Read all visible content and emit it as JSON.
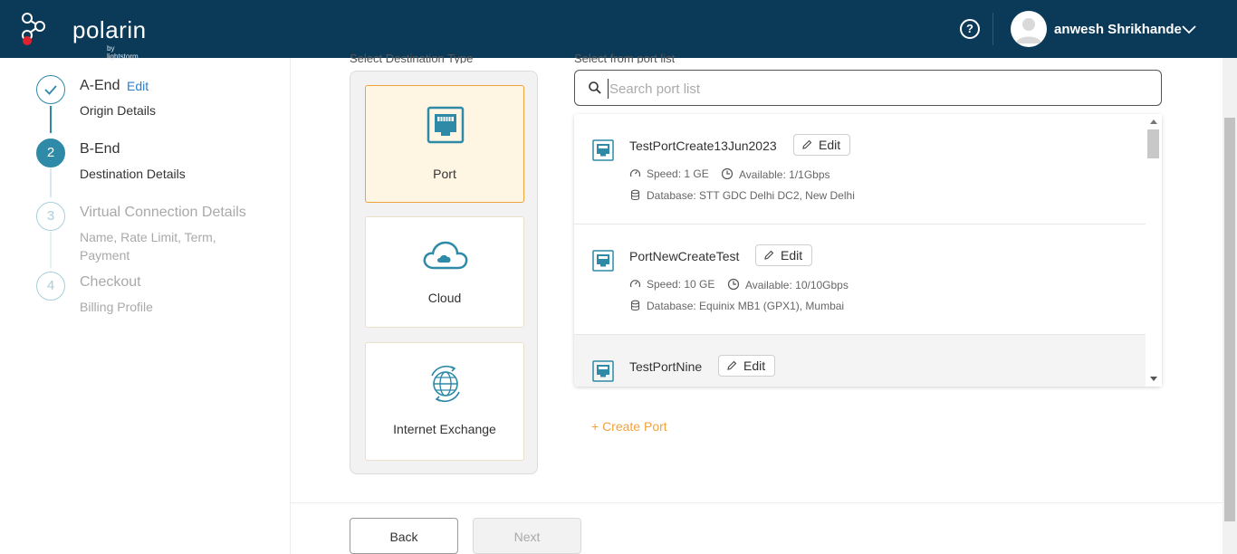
{
  "header": {
    "brand": "polarin",
    "brand_sub": "by lightstorm",
    "help": "?",
    "user_name": "anwesh Shrikhande"
  },
  "steps": [
    {
      "number": "",
      "title": "A-End",
      "edit": "Edit",
      "sub": "Origin Details",
      "state": "done"
    },
    {
      "number": "2",
      "title": "B-End",
      "sub": "Destination Details",
      "state": "active"
    },
    {
      "number": "3",
      "title": "Virtual Connection Details",
      "sub_line1": "Name, Rate Limit, Term,",
      "sub_line2": "Payment",
      "state": "pending"
    },
    {
      "number": "4",
      "title": "Checkout",
      "sub": "Billing Profile",
      "state": "pending"
    }
  ],
  "destination": {
    "label": "Select Destination Type",
    "options": [
      {
        "label": "Port",
        "icon": "port-icon",
        "selected": true
      },
      {
        "label": "Cloud",
        "icon": "cloud-icon",
        "selected": false
      },
      {
        "label": "Internet Exchange",
        "icon": "globe-icon",
        "selected": false
      }
    ]
  },
  "port_list": {
    "label": "Select from port list",
    "search_placeholder": "Search port list",
    "items": [
      {
        "name": "TestPortCreate13Jun2023",
        "edit": "Edit",
        "speed": "Speed: 1 GE",
        "available": "Available: 1/1Gbps",
        "database": "Database: STT GDC Delhi DC2, New Delhi"
      },
      {
        "name": "PortNewCreateTest",
        "edit": "Edit",
        "speed": "Speed: 10 GE",
        "available": "Available: 10/10Gbps",
        "database": "Database: Equinix MB1 (GPX1), Mumbai"
      },
      {
        "name": "TestPortNine",
        "edit": "Edit"
      }
    ],
    "create_label": "+ Create Port"
  },
  "footer": {
    "back": "Back",
    "next": "Next"
  },
  "colors": {
    "header_bg": "#0b3a59",
    "accent_teal": "#2e8aa6",
    "accent_orange": "#f0a23b",
    "link_blue": "#2b7fd0"
  }
}
